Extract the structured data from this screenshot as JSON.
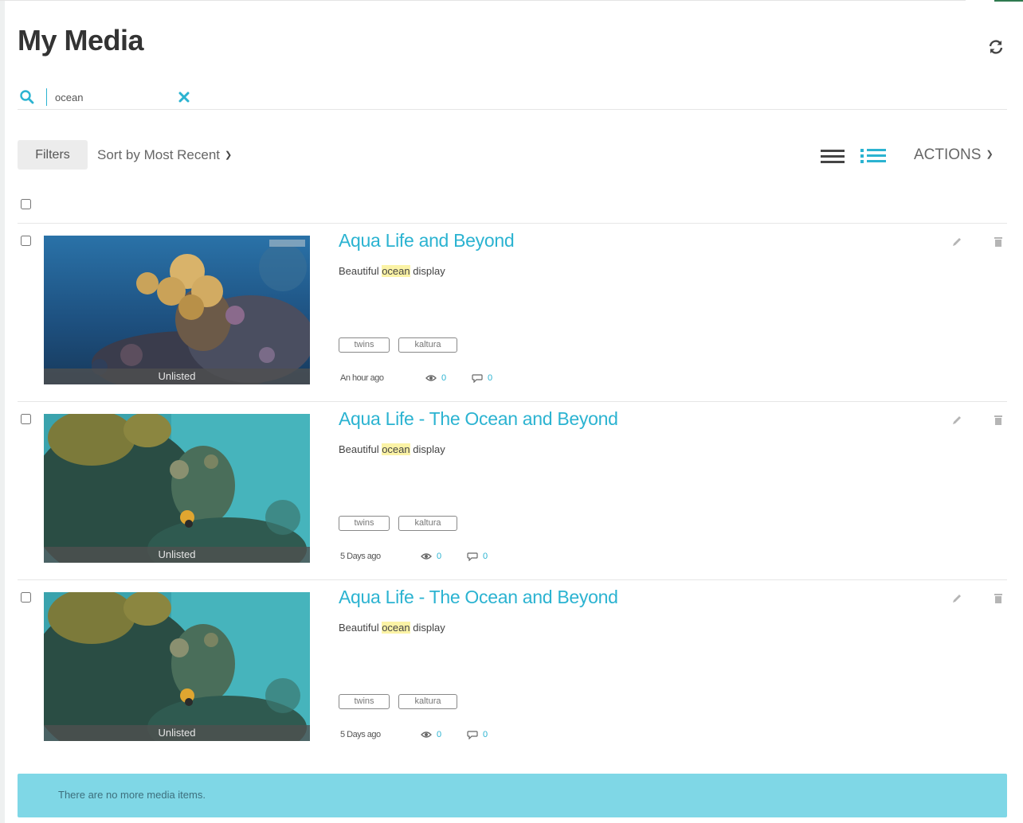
{
  "page": {
    "title": "My Media"
  },
  "search": {
    "value": "ocean"
  },
  "toolbar": {
    "filters_label": "Filters",
    "sort_label": "Sort by Most Recent",
    "actions_label": "ACTIONS"
  },
  "colors": {
    "accent": "#2bb3d1",
    "highlight": "#fbf3a6",
    "notice_bg": "#7fd7e6"
  },
  "entries": [
    {
      "title": "Aqua Life and Beyond",
      "desc_before": "Beautiful ",
      "desc_highlight": "ocean",
      "desc_after": " display",
      "status": "Unlisted",
      "tags": [
        "twins",
        "kaltura"
      ],
      "time": "An hour ago",
      "views": "0",
      "comments": "0"
    },
    {
      "title": "Aqua Life - The Ocean and Beyond",
      "desc_before": "Beautiful ",
      "desc_highlight": "ocean",
      "desc_after": " display",
      "status": "Unlisted",
      "tags": [
        "twins",
        "kaltura"
      ],
      "time": "5 Days ago",
      "views": "0",
      "comments": "0"
    },
    {
      "title": "Aqua Life - The Ocean and Beyond",
      "desc_before": "Beautiful ",
      "desc_highlight": "ocean",
      "desc_after": " display",
      "status": "Unlisted",
      "tags": [
        "twins",
        "kaltura"
      ],
      "time": "5 Days ago",
      "views": "0",
      "comments": "0"
    }
  ],
  "footer": {
    "message": "There are no more media items."
  }
}
